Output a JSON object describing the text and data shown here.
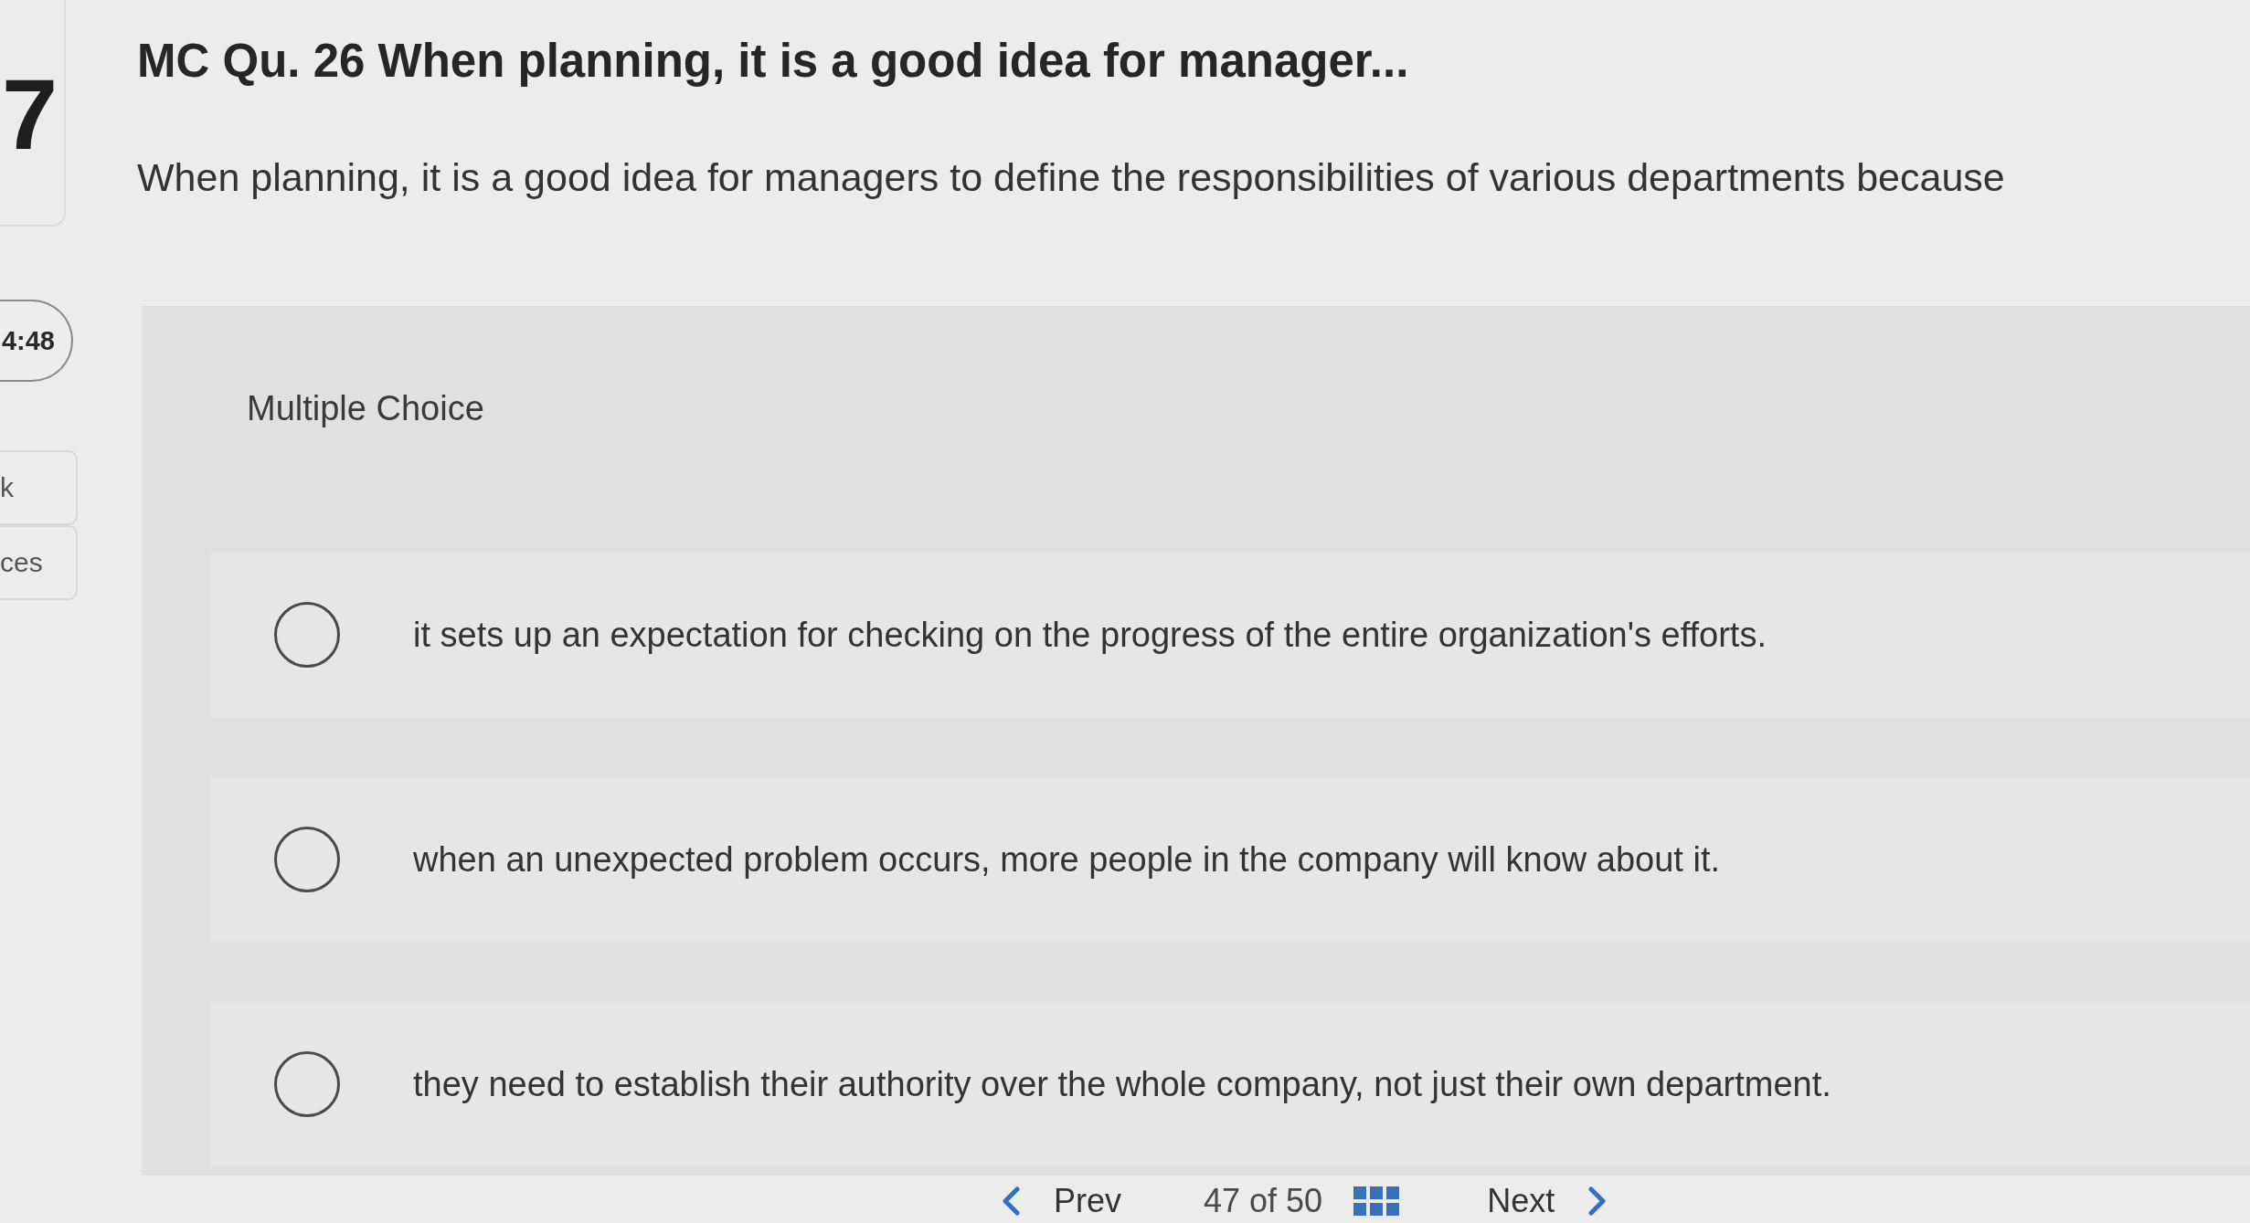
{
  "sidebar": {
    "question_badge": "7",
    "timer": "4:48",
    "items": [
      {
        "label": "k"
      },
      {
        "label": "ces"
      }
    ]
  },
  "question": {
    "title": "MC Qu. 26 When planning, it is a good idea for manager...",
    "prompt": "When planning, it is a good idea for managers to define the responsibilities of various departments because",
    "type_label": "Multiple Choice",
    "options": [
      {
        "text": "it sets up an expectation for checking on the progress of the entire organization's efforts.",
        "selected": false
      },
      {
        "text": "when an unexpected problem occurs, more people in the company will know about it.",
        "selected": false
      },
      {
        "text": "they need to establish their authority over the whole company, not just their own department.",
        "selected": false
      }
    ]
  },
  "pagination": {
    "prev": "Prev",
    "position": "47 of 50",
    "next": "Next"
  }
}
